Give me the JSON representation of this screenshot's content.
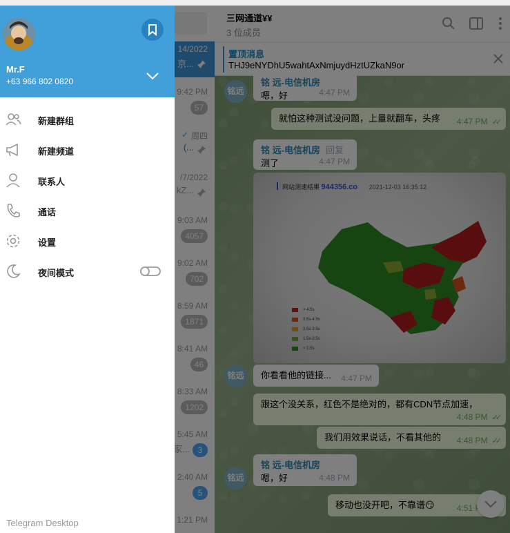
{
  "chatlist": {
    "rows": [
      {
        "time": "14/2022",
        "sub": "京...",
        "active": true
      },
      {
        "time": "9:42 PM",
        "badge": "57"
      },
      {
        "time": "周四",
        "sub": "(...",
        "check": true
      },
      {
        "time": "/7/2022",
        "sub": "kZ..."
      },
      {
        "time": "9:03 AM",
        "badge": "4057"
      },
      {
        "time": "9:02 AM",
        "badge": "702"
      },
      {
        "time": "8:59 AM",
        "badge": "1871"
      },
      {
        "time": "8:41 AM",
        "badge": "46"
      },
      {
        "time": "8:33 AM",
        "badge": "1202"
      },
      {
        "time": "5:45 AM",
        "sub": "家...",
        "badge": "3",
        "blue": true
      },
      {
        "time": "2:40 AM",
        "badge": "5",
        "blue": true
      },
      {
        "time": "1:21 PM"
      }
    ]
  },
  "chat": {
    "title": "三网通道¥¥",
    "members": "3 位成员",
    "pinned_title": "置顶消息",
    "pinned_text": "THJ9eNYDhU5wahtAxNmjuydHztUZkaN9or",
    "messages": {
      "m1_name": "铭 远-电信机房",
      "m1_text": "嗯，好",
      "m1_time": "4:47 PM",
      "m2_text": "就怕这种测试没问题，上量就翻车，头疼",
      "m2_time": "4:47 PM",
      "m3_name": "铭 远-电信机房",
      "m3_reply": "回复",
      "m3_text": "测了",
      "m3_time": "4:47 PM",
      "img_title": "网站测速结果",
      "img_site": "944356.co",
      "img_date": "2021-12-03 16:35:12",
      "m4_text": "你看看他的链接...",
      "m4_time": "4:47 PM",
      "m5_text": "跟这个没关系，红色不是绝对的，都有CDN节点加速，",
      "m5_time": "4:48 PM",
      "m6_text": "我们用效果说话，不看其他的",
      "m6_time": "4:48 PM",
      "m7_name": "铭 远-电信机房",
      "m7_text": "嗯，好",
      "m7_time": "4:48 PM",
      "m8_text": "移动也没开吧，不靠谱😏",
      "m8_time": "4:51 PM"
    },
    "avatar_label": "铭远",
    "legend": [
      {
        "label": "> 4.5s",
        "color": "#c0201f"
      },
      {
        "label": "3.5s-4.5s",
        "color": "#d9531e"
      },
      {
        "label": "2.5s-3.5s",
        "color": "#d4a017"
      },
      {
        "label": "1.5s-2.5s",
        "color": "#7aa52a"
      },
      {
        "label": "< 1.5s",
        "color": "#2e8b1e"
      }
    ]
  },
  "drawer": {
    "name": "Mr.F",
    "phone": "+63 966 802 0820",
    "menu": [
      {
        "label": "新建群组",
        "icon": "group-icon"
      },
      {
        "label": "新建频道",
        "icon": "megaphone-icon"
      },
      {
        "label": "联系人",
        "icon": "contact-icon"
      },
      {
        "label": "通话",
        "icon": "phone-icon"
      },
      {
        "label": "设置",
        "icon": "gear-icon"
      },
      {
        "label": "夜间模式",
        "icon": "moon-icon"
      }
    ],
    "footer": "Telegram Desktop",
    "header_color": "#419fd9"
  }
}
